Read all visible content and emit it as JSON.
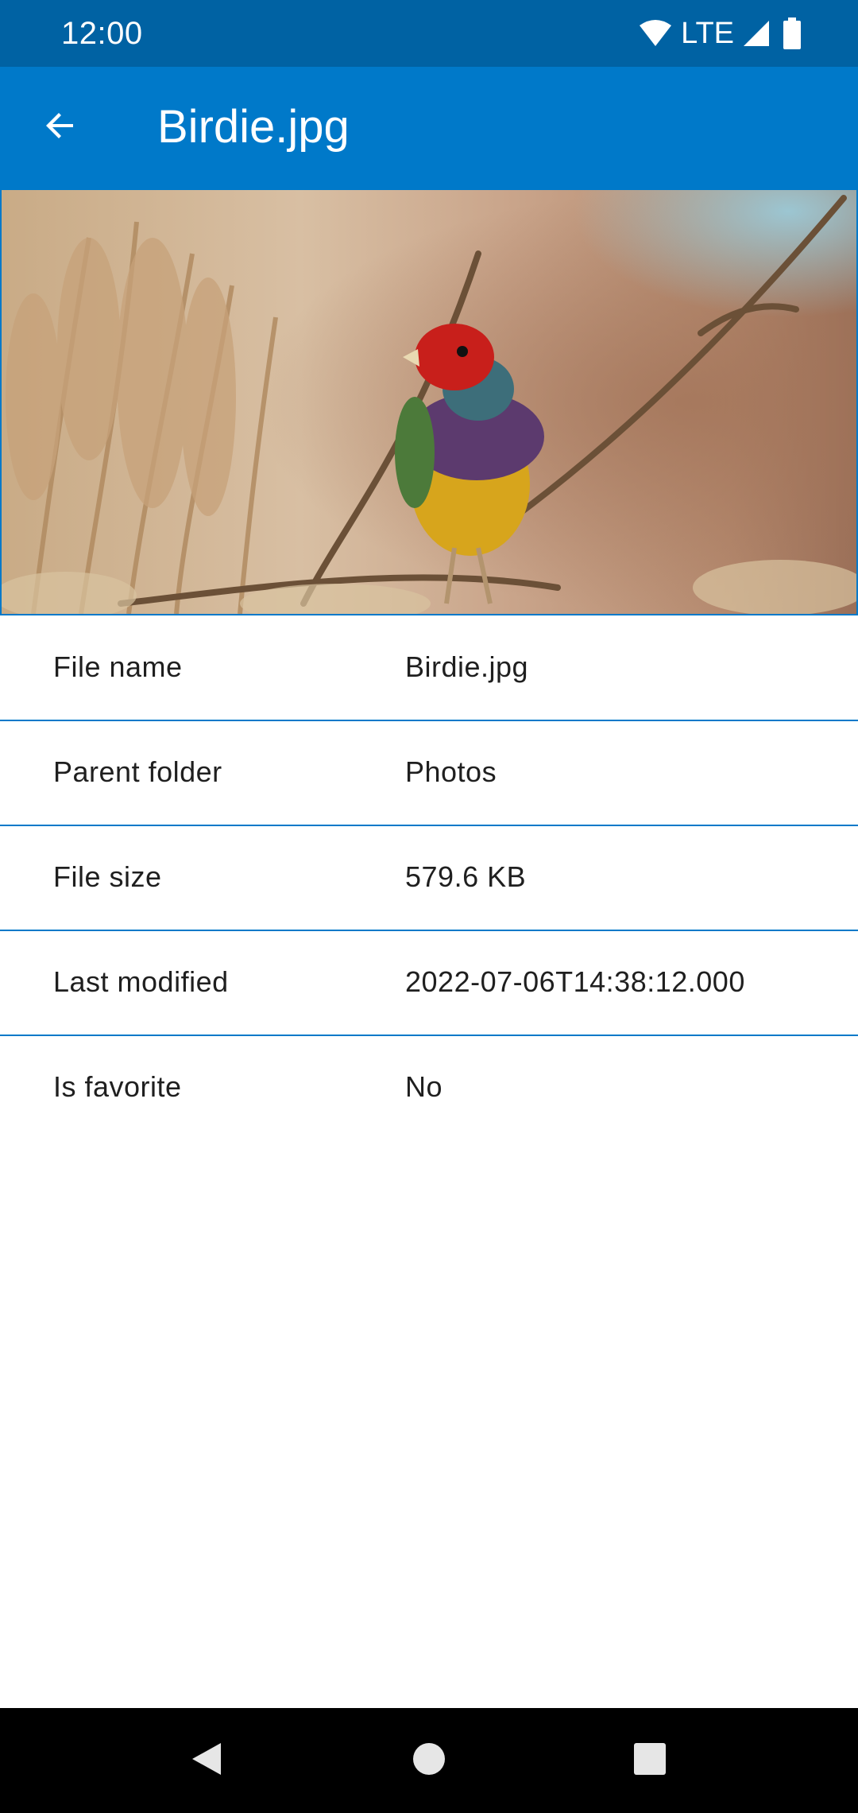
{
  "status_bar": {
    "time": "12:00",
    "network": "LTE",
    "icons": [
      "wifi-icon",
      "signal-icon",
      "battery-icon"
    ]
  },
  "app_bar": {
    "title": "Birdie.jpg",
    "back_icon": "arrow-left-icon"
  },
  "hero_image": {
    "subject": "bird-photo"
  },
  "details": [
    {
      "label": "File name",
      "value": "Birdie.jpg"
    },
    {
      "label": "Parent folder",
      "value": "Photos"
    },
    {
      "label": "File size",
      "value": "579.6 KB"
    },
    {
      "label": "Last modified",
      "value": "2022-07-06T14:38:12.000"
    },
    {
      "label": "Is favorite",
      "value": "No"
    }
  ],
  "nav_bar": {
    "icons": [
      "nav-back-icon",
      "nav-home-icon",
      "nav-recents-icon"
    ]
  },
  "colors": {
    "status_bar": "#0062a3",
    "app_bar": "#0079c9",
    "divider": "#0079c9",
    "text": "#1f1f1f",
    "nav_bar": "#000000"
  }
}
